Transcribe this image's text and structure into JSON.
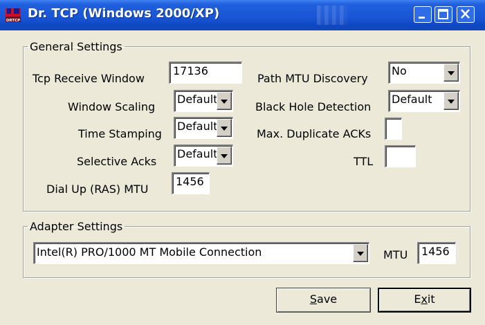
{
  "window": {
    "title": "Dr. TCP (Windows 2000/XP)",
    "icon_text": "DRTCP"
  },
  "general": {
    "legend": "General Settings",
    "tcp_receive_window": {
      "label": "Tcp Receive Window",
      "value": "17136"
    },
    "window_scaling": {
      "label": "Window Scaling",
      "value": "Default"
    },
    "time_stamping": {
      "label": "Time Stamping",
      "value": "Default"
    },
    "selective_acks": {
      "label": "Selective Acks",
      "value": "Default"
    },
    "dial_up_mtu": {
      "label": "Dial Up (RAS) MTU",
      "value": "1456"
    },
    "path_mtu_discovery": {
      "label": "Path MTU Discovery",
      "value": "No"
    },
    "black_hole_detection": {
      "label": "Black Hole Detection",
      "value": "Default"
    },
    "max_duplicate_acks": {
      "label": "Max. Duplicate ACKs",
      "value": ""
    },
    "ttl": {
      "label": "TTL",
      "value": ""
    }
  },
  "adapter": {
    "legend": "Adapter Settings",
    "selected": "Intel(R) PRO/1000 MT Mobile Connection",
    "mtu_label": "MTU",
    "mtu_value": "1456"
  },
  "buttons": {
    "save_prefix": "",
    "save_accel": "S",
    "save_rest": "ave",
    "exit_prefix": "E",
    "exit_accel": "x",
    "exit_rest": "it"
  },
  "colors": {
    "titlebar": "#1a56d6",
    "dialog": "#ece9d8"
  }
}
